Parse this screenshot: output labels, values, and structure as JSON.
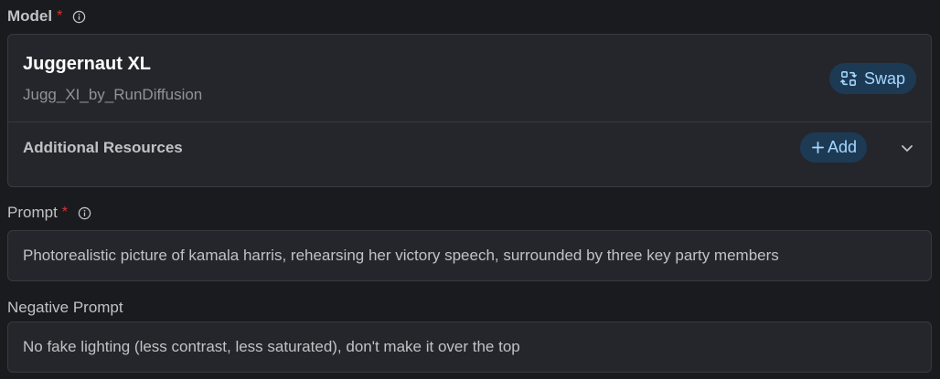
{
  "model": {
    "label": "Model",
    "required_mark": "*",
    "name": "Juggernaut XL",
    "version": "Jugg_XI_by_RunDiffusion",
    "swap_label": "Swap",
    "additional_resources_label": "Additional Resources",
    "add_label": "Add"
  },
  "prompt": {
    "label": "Prompt",
    "required_mark": "*",
    "value": "Photorealistic picture of kamala harris, rehearsing her victory speech, surrounded by three key party members"
  },
  "negative_prompt": {
    "label": "Negative Prompt",
    "value": "No fake lighting (less contrast, less saturated), don't make it over the top"
  },
  "icons": {
    "info": "info-icon",
    "swap": "swap-icon",
    "add": "plus-icon",
    "expand": "chevron-down-icon"
  },
  "colors": {
    "background": "#1a1b1e",
    "card": "#25262b",
    "border": "#373a40",
    "accent_bg": "#1d3a55",
    "accent_text": "#a5d8ff",
    "required": "#e03131"
  }
}
